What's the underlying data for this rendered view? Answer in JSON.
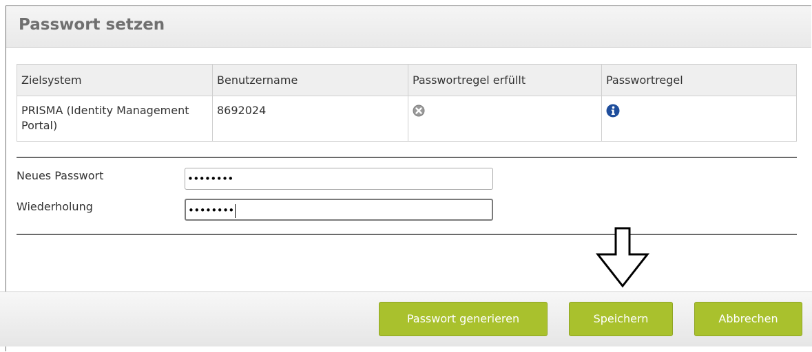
{
  "dialog": {
    "title": "Passwort setzen"
  },
  "table": {
    "headers": [
      "Zielsystem",
      "Benutzername",
      "Passwortregel erfüllt",
      "Passwortregel"
    ],
    "rows": [
      {
        "system": "PRISMA (Identity Management Portal)",
        "username": "8692024",
        "rule_met_icon": "error-circle-icon",
        "rule_icon": "info-icon"
      }
    ]
  },
  "form": {
    "new_password_label": "Neues Passwort",
    "new_password_mask": "••••••••",
    "repeat_label": "Wiederholung",
    "repeat_mask": "••••••••"
  },
  "footer": {
    "generate_label": "Passwort generieren",
    "save_label": "Speichern",
    "cancel_label": "Abbrechen"
  },
  "annotation": {
    "arrow_icon": "down-arrow-icon"
  },
  "colors": {
    "button": "#a9c12d",
    "info": "#1f4e9c",
    "error": "#9a9a9a"
  }
}
